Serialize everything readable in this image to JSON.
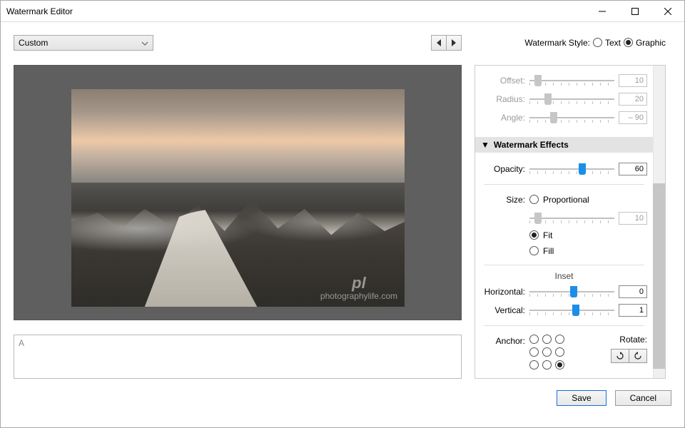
{
  "window": {
    "title": "Watermark Editor"
  },
  "preset": {
    "selected": "Custom"
  },
  "textarea": {
    "value": "A"
  },
  "watermark_style": {
    "label": "Watermark Style:",
    "text_label": "Text",
    "graphic_label": "Graphic",
    "selected": "Graphic"
  },
  "disabled_controls": {
    "offset": {
      "label": "Offset:",
      "value": "10"
    },
    "radius": {
      "label": "Radius:",
      "value": "20"
    },
    "angle": {
      "label": "Angle:",
      "value": "– 90"
    }
  },
  "effects": {
    "header": "Watermark Effects",
    "opacity": {
      "label": "Opacity:",
      "value": "60"
    },
    "size_label": "Size:",
    "proportional_label": "Proportional",
    "proportional_value": "10",
    "fit_label": "Fit",
    "fill_label": "Fill",
    "size_mode": "Fit",
    "inset_label": "Inset",
    "horizontal": {
      "label": "Horizontal:",
      "value": "0"
    },
    "vertical": {
      "label": "Vertical:",
      "value": "1"
    },
    "anchor_label": "Anchor:",
    "rotate_label": "Rotate:"
  },
  "watermark_preview": {
    "logo": "pl",
    "sub": "photographylife.com"
  },
  "footer": {
    "save": "Save",
    "cancel": "Cancel"
  }
}
